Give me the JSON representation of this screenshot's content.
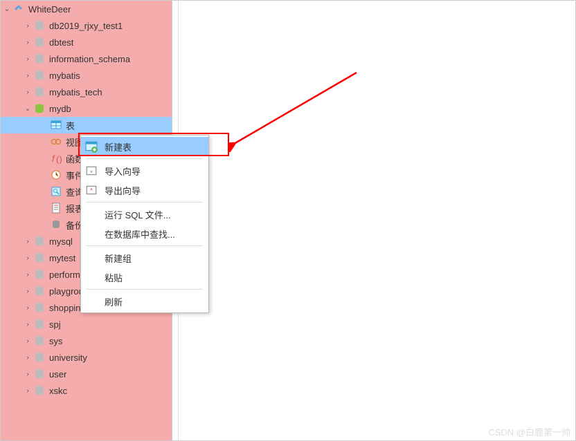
{
  "connection": {
    "name": "WhiteDeer"
  },
  "databases": [
    {
      "name": "db2019_rjxy_test1"
    },
    {
      "name": "dbtest"
    },
    {
      "name": "information_schema"
    },
    {
      "name": "mybatis"
    },
    {
      "name": "mybatis_tech"
    },
    {
      "name": "mydb",
      "expanded": true,
      "active": true
    }
  ],
  "mydb_children": [
    {
      "name": "表",
      "selected": true,
      "icon": "table"
    },
    {
      "name": "视图",
      "icon": "view"
    },
    {
      "name": "函数",
      "icon": "function"
    },
    {
      "name": "事件",
      "icon": "event"
    },
    {
      "name": "查询",
      "icon": "query"
    },
    {
      "name": "报表",
      "icon": "report"
    },
    {
      "name": "备份",
      "icon": "backup"
    }
  ],
  "databases_after": [
    {
      "name": "mysql"
    },
    {
      "name": "mytest"
    },
    {
      "name": "performance_schema"
    },
    {
      "name": "playground"
    },
    {
      "name": "shopping"
    },
    {
      "name": "spj"
    },
    {
      "name": "sys"
    },
    {
      "name": "university"
    },
    {
      "name": "user"
    },
    {
      "name": "xskc"
    }
  ],
  "context_menu": {
    "new_table": "新建表",
    "import_wizard": "导入向导",
    "export_wizard": "导出向导",
    "run_sql": "运行 SQL 文件...",
    "find_in_db": "在数据库中查找...",
    "new_group": "新建组",
    "paste": "粘贴",
    "refresh": "刷新"
  },
  "watermark": "CSDN @白鹿第一帅"
}
